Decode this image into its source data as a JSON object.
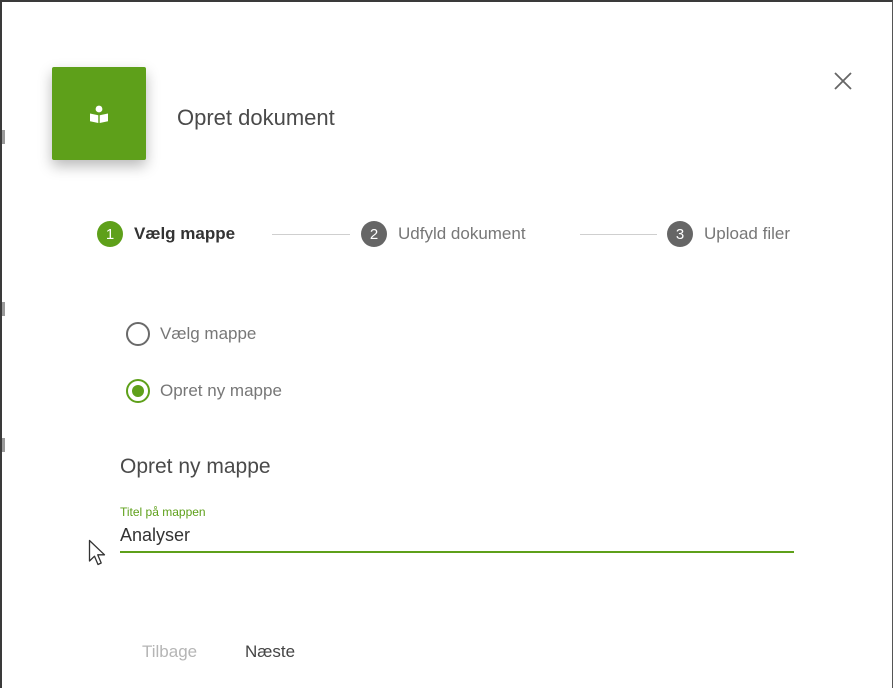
{
  "dialog": {
    "title": "Opret dokument",
    "header_icon": "document-reader-icon",
    "close_icon": "close-icon"
  },
  "stepper": {
    "steps": [
      {
        "number": "1",
        "label": "Vælg mappe",
        "state": "active"
      },
      {
        "number": "2",
        "label": "Udfyld dokument",
        "state": "inactive"
      },
      {
        "number": "3",
        "label": "Upload filer",
        "state": "inactive"
      }
    ]
  },
  "options": [
    {
      "label": "Vælg mappe",
      "checked": false
    },
    {
      "label": "Opret ny mappe",
      "checked": true
    }
  ],
  "section": {
    "heading": "Opret ny mappe"
  },
  "field": {
    "label": "Titel på mappen",
    "value": "Analyser"
  },
  "actions": {
    "back": "Tilbage",
    "next": "Næste"
  },
  "colors": {
    "accent": "#5ea01a",
    "inactive_step": "#666666"
  }
}
